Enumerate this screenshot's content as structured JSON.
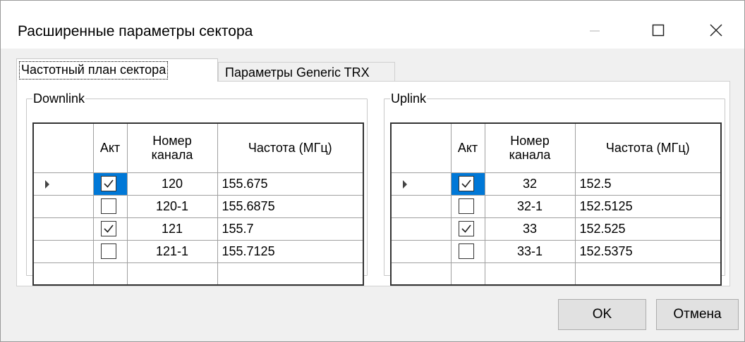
{
  "window": {
    "title": "Расширенные параметры сектора",
    "controls": [
      "minimize-icon",
      "maximize-icon",
      "close-icon"
    ]
  },
  "tabs": [
    {
      "label": "Частотный план сектора",
      "active": true
    },
    {
      "label": "Параметры Generic TRX",
      "active": false
    }
  ],
  "downlink": {
    "legend": "Downlink",
    "columns": [
      "",
      "Акт",
      "Номер канала",
      "Частота (МГц)"
    ],
    "columns_split": {
      "channel_line1": "Номер",
      "channel_line2": "канала"
    },
    "rows": [
      {
        "current": true,
        "active": true,
        "channel": "120",
        "freq": "155.675"
      },
      {
        "current": false,
        "active": false,
        "channel": "120-1",
        "freq": "155.6875"
      },
      {
        "current": false,
        "active": true,
        "channel": "121",
        "freq": "155.7"
      },
      {
        "current": false,
        "active": false,
        "channel": "121-1",
        "freq": "155.7125"
      }
    ]
  },
  "uplink": {
    "legend": "Uplink",
    "columns": [
      "",
      "Акт",
      "Номер канала",
      "Частота (МГц)"
    ],
    "columns_split": {
      "channel_line1": "Номер",
      "channel_line2": "канала"
    },
    "rows": [
      {
        "current": true,
        "active": true,
        "channel": "32",
        "freq": "152.5"
      },
      {
        "current": false,
        "active": false,
        "channel": "32-1",
        "freq": "152.5125"
      },
      {
        "current": false,
        "active": true,
        "channel": "33",
        "freq": "152.525"
      },
      {
        "current": false,
        "active": false,
        "channel": "33-1",
        "freq": "152.5375"
      }
    ]
  },
  "buttons": {
    "ok": "OK",
    "cancel": "Отмена"
  },
  "colors": {
    "selection": "#0078d7",
    "panel": "#ffffff",
    "dialog": "#f0f0f0"
  }
}
